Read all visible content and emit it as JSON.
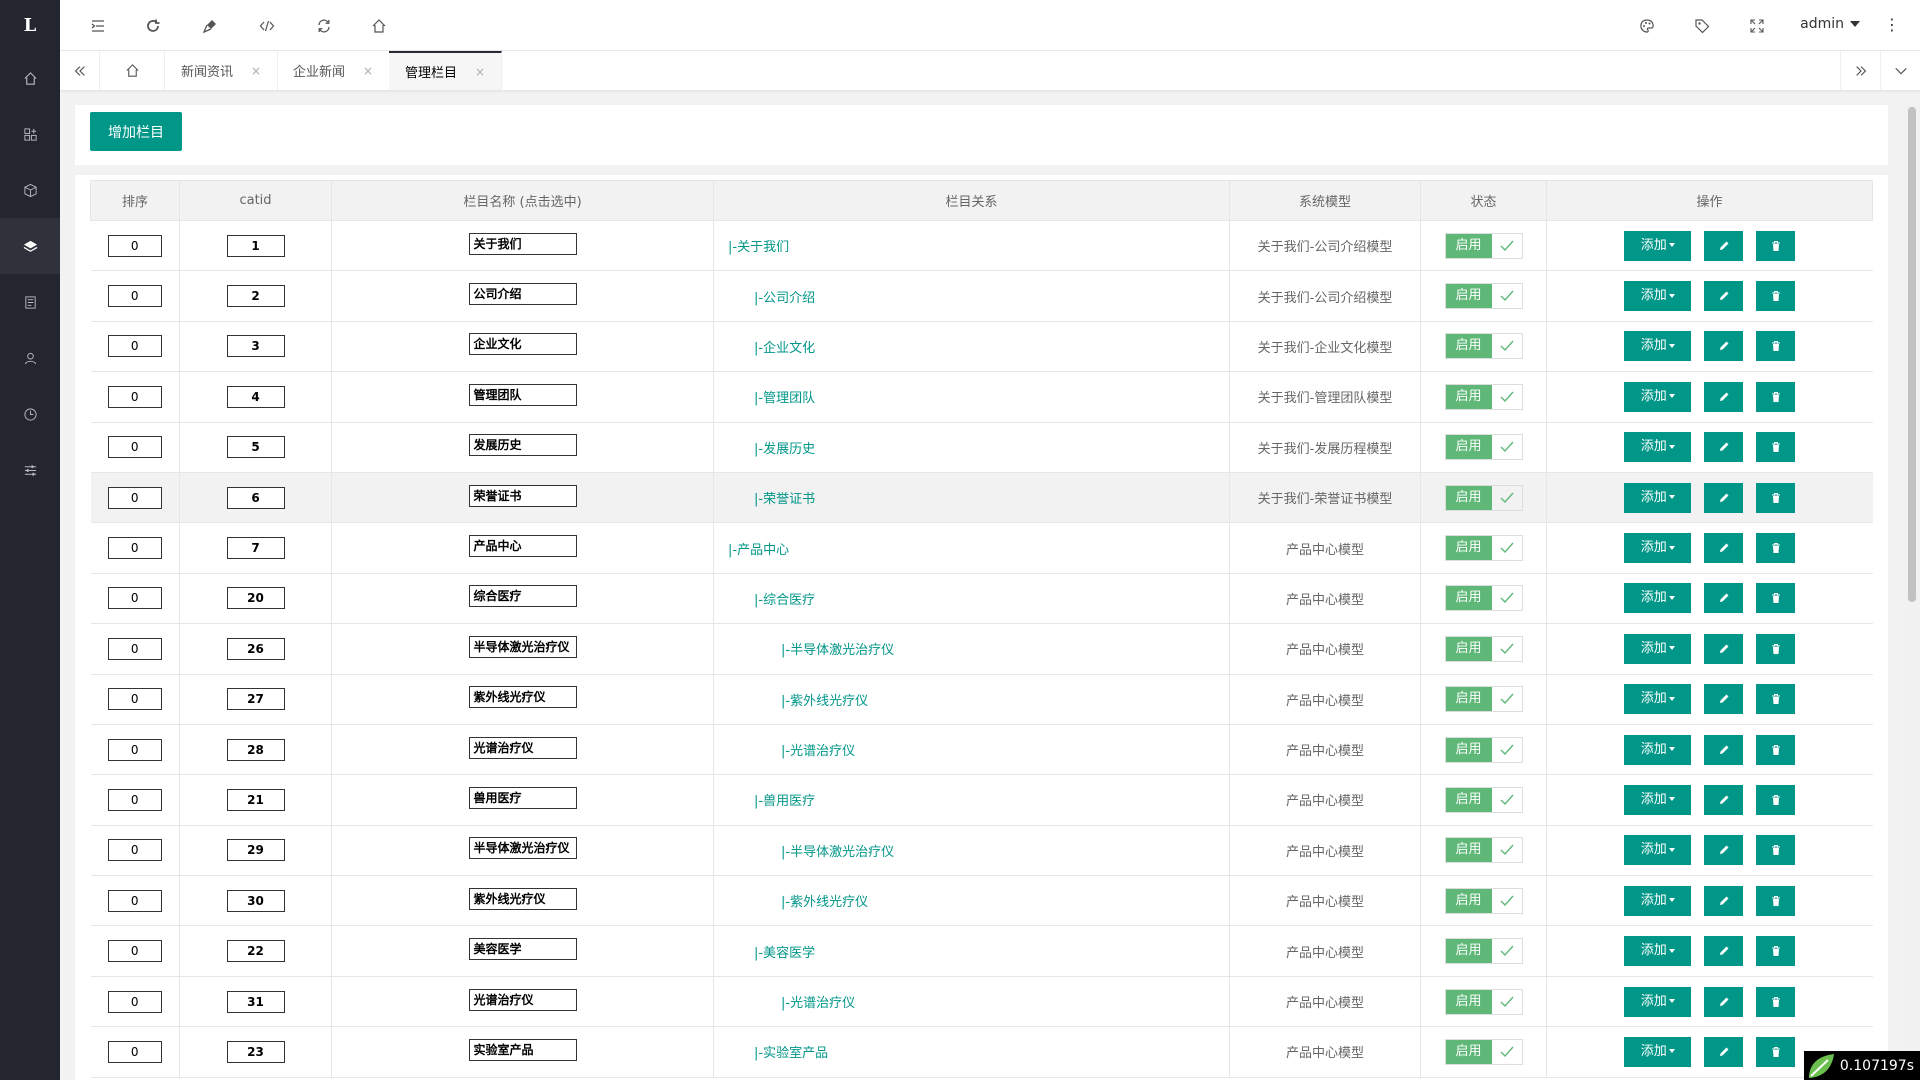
{
  "app": {
    "logo": "L"
  },
  "header": {
    "user": "admin",
    "more": "⋮"
  },
  "tabs": [
    {
      "label": "新闻资讯",
      "close": "×"
    },
    {
      "label": "企业新闻",
      "close": "×"
    },
    {
      "label": "管理栏目",
      "close": "×"
    }
  ],
  "toolbar": {
    "add_label": "增加栏目"
  },
  "table": {
    "headers": [
      "排序",
      "catid",
      "栏目名称 (点击选中)",
      "栏目关系",
      "系统模型",
      "状态",
      "操作"
    ],
    "enable_label": "启用",
    "add_label": "添加",
    "rows": [
      {
        "order": "0",
        "catid": "1",
        "name": "关于我们",
        "rel": "|-关于我们",
        "level": 0,
        "model": "关于我们-公司介绍模型"
      },
      {
        "order": "0",
        "catid": "2",
        "name": "公司介绍",
        "rel": "|-公司介绍",
        "level": 1,
        "model": "关于我们-公司介绍模型"
      },
      {
        "order": "0",
        "catid": "3",
        "name": "企业文化",
        "rel": "|-企业文化",
        "level": 1,
        "model": "关于我们-企业文化模型"
      },
      {
        "order": "0",
        "catid": "4",
        "name": "管理团队",
        "rel": "|-管理团队",
        "level": 1,
        "model": "关于我们-管理团队模型"
      },
      {
        "order": "0",
        "catid": "5",
        "name": "发展历史",
        "rel": "|-发展历史",
        "level": 1,
        "model": "关于我们-发展历程模型"
      },
      {
        "order": "0",
        "catid": "6",
        "name": "荣誉证书",
        "rel": "|-荣誉证书",
        "level": 1,
        "model": "关于我们-荣誉证书模型"
      },
      {
        "order": "0",
        "catid": "7",
        "name": "产品中心",
        "rel": "|-产品中心",
        "level": 0,
        "model": "产品中心模型"
      },
      {
        "order": "0",
        "catid": "20",
        "name": "综合医疗",
        "rel": "|-综合医疗",
        "level": 1,
        "model": "产品中心模型"
      },
      {
        "order": "0",
        "catid": "26",
        "name": "半导体激光治疗仪",
        "rel": "|-半导体激光治疗仪",
        "level": 2,
        "model": "产品中心模型"
      },
      {
        "order": "0",
        "catid": "27",
        "name": "紫外线光疗仪",
        "rel": "|-紫外线光疗仪",
        "level": 2,
        "model": "产品中心模型"
      },
      {
        "order": "0",
        "catid": "28",
        "name": "光谱治疗仪",
        "rel": "|-光谱治疗仪",
        "level": 2,
        "model": "产品中心模型"
      },
      {
        "order": "0",
        "catid": "21",
        "name": "兽用医疗",
        "rel": "|-兽用医疗",
        "level": 1,
        "model": "产品中心模型"
      },
      {
        "order": "0",
        "catid": "29",
        "name": "半导体激光治疗仪",
        "rel": "|-半导体激光治疗仪",
        "level": 2,
        "model": "产品中心模型"
      },
      {
        "order": "0",
        "catid": "30",
        "name": "紫外线光疗仪",
        "rel": "|-紫外线光疗仪",
        "level": 2,
        "model": "产品中心模型"
      },
      {
        "order": "0",
        "catid": "22",
        "name": "美容医学",
        "rel": "|-美容医学",
        "level": 1,
        "model": "产品中心模型"
      },
      {
        "order": "0",
        "catid": "31",
        "name": "光谱治疗仪",
        "rel": "|-光谱治疗仪",
        "level": 2,
        "model": "产品中心模型"
      },
      {
        "order": "0",
        "catid": "23",
        "name": "实验室产品",
        "rel": "|-实验室产品",
        "level": 1,
        "model": "产品中心模型"
      }
    ]
  },
  "timer": "0.107197s",
  "colors": {
    "primary": "#009688",
    "switch_on": "#5fb878",
    "sidebar": "#23262e"
  }
}
